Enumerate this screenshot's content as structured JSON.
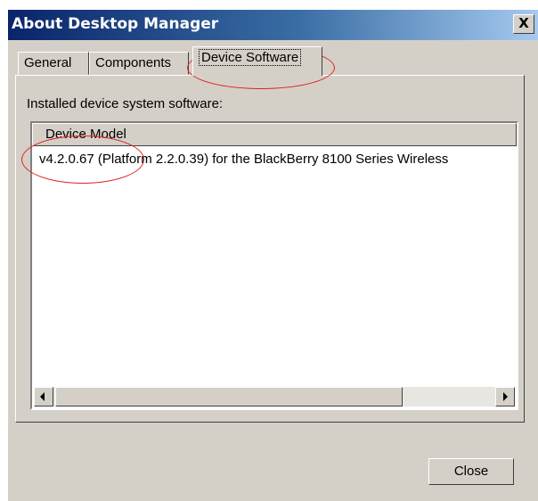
{
  "window": {
    "title": "About Desktop Manager",
    "close_glyph": "X"
  },
  "tabs": [
    {
      "label": "General"
    },
    {
      "label": "Components"
    },
    {
      "label": "Device Software"
    }
  ],
  "panel": {
    "installed_label": "Installed device system software:",
    "column_header": "Device Model",
    "rows": [
      "v4.2.0.67 (Platform 2.2.0.39) for the BlackBerry 8100 Series Wireless"
    ]
  },
  "buttons": {
    "close": "Close"
  },
  "colors": {
    "annotation": "#e02020",
    "titlebar_start": "#0a246a",
    "face": "#d4d0c8"
  },
  "icons": [
    "scroll-left-arrow-icon",
    "scroll-right-arrow-icon"
  ]
}
